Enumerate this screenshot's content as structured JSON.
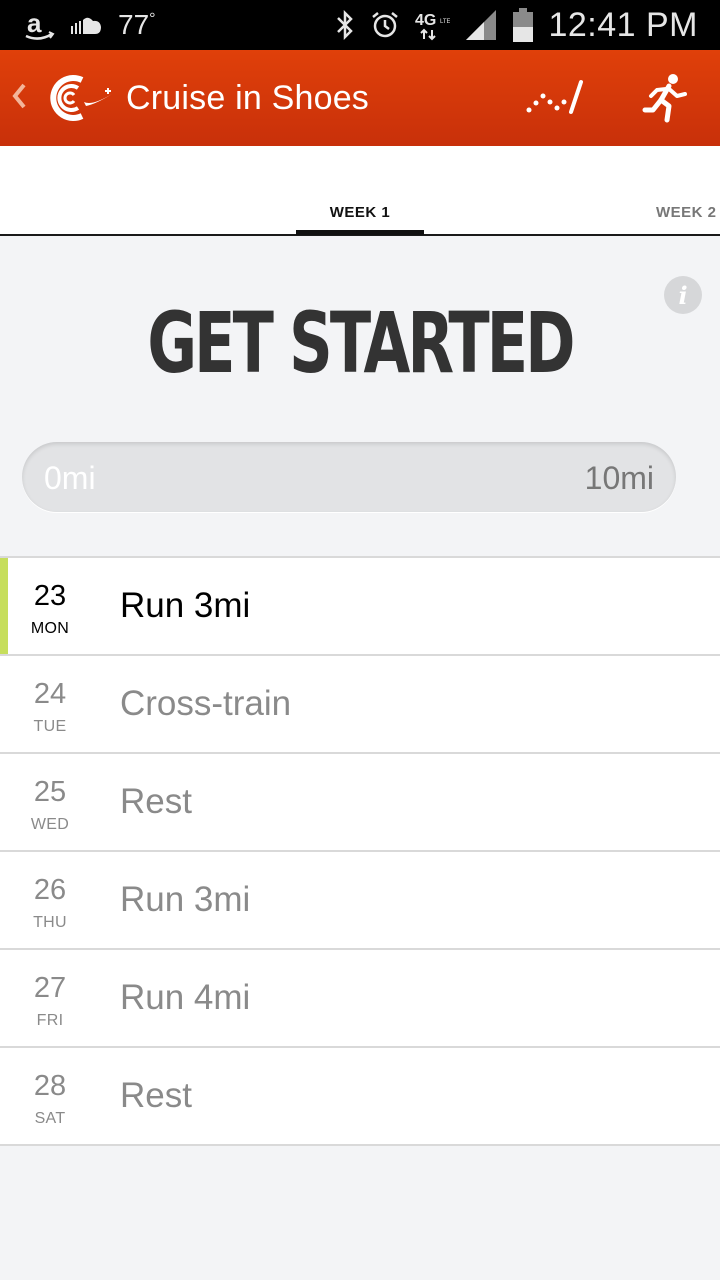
{
  "status_bar": {
    "temperature": "77",
    "degree": "°",
    "network": "4G",
    "time": "12:41 PM",
    "icons": [
      "amazon-icon",
      "soundcloud-icon",
      "bluetooth-icon",
      "alarm-icon",
      "lte-icon",
      "signal-icon",
      "battery-icon"
    ]
  },
  "app_bar": {
    "title": "Cruise in Shoes",
    "back_icon": "chevron-left-icon",
    "logo_icon": "nike-running-logo-icon",
    "actions": [
      "stats-icon",
      "run-icon"
    ],
    "color": "#d63a0a"
  },
  "tabs": [
    {
      "label": "WEEK 1",
      "selected": true
    },
    {
      "label": "WEEK 2",
      "selected": false
    }
  ],
  "main": {
    "headline": "GET STARTED",
    "info_icon": "info-icon",
    "progress": {
      "start_label": "0mi",
      "end_label": "10mi",
      "fraction": 0
    }
  },
  "schedule": [
    {
      "day": "23",
      "weekday": "MON",
      "task": "Run 3mi",
      "active": true
    },
    {
      "day": "24",
      "weekday": "TUE",
      "task": "Cross-train",
      "active": false
    },
    {
      "day": "25",
      "weekday": "WED",
      "task": "Rest",
      "active": false
    },
    {
      "day": "26",
      "weekday": "THU",
      "task": "Run 3mi",
      "active": false
    },
    {
      "day": "27",
      "weekday": "FRI",
      "task": "Run 4mi",
      "active": false
    },
    {
      "day": "28",
      "weekday": "SAT",
      "task": "Rest",
      "active": false
    }
  ],
  "colors": {
    "accent_today": "#c6de5c",
    "app_bar": "#d63a0a"
  }
}
